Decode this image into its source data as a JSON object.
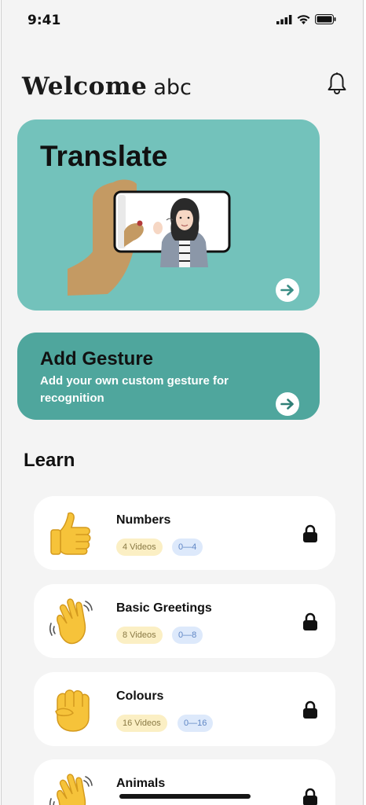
{
  "status_bar": {
    "time": "9:41"
  },
  "header": {
    "welcome": "Welcome",
    "username": "abc"
  },
  "translate_card": {
    "title": "Translate",
    "color": "#73c2bb"
  },
  "gesture_card": {
    "title": "Add Gesture",
    "subtitle": "Add your own custom gesture for recognition",
    "color": "#4fa69d"
  },
  "learn": {
    "heading": "Learn",
    "lessons": [
      {
        "title": "Numbers",
        "videos": "4 Videos",
        "range": "0—4",
        "icon": "thumbs-up-icon"
      },
      {
        "title": "Basic Greetings",
        "videos": "8 Videos",
        "range": "0—8",
        "icon": "waving-hand-icon"
      },
      {
        "title": "Colours",
        "videos": "16 Videos",
        "range": "0—16",
        "icon": "raised-fist-icon"
      },
      {
        "title": "Animals",
        "videos": "",
        "range": "",
        "icon": "waving-hand-icon"
      }
    ]
  }
}
